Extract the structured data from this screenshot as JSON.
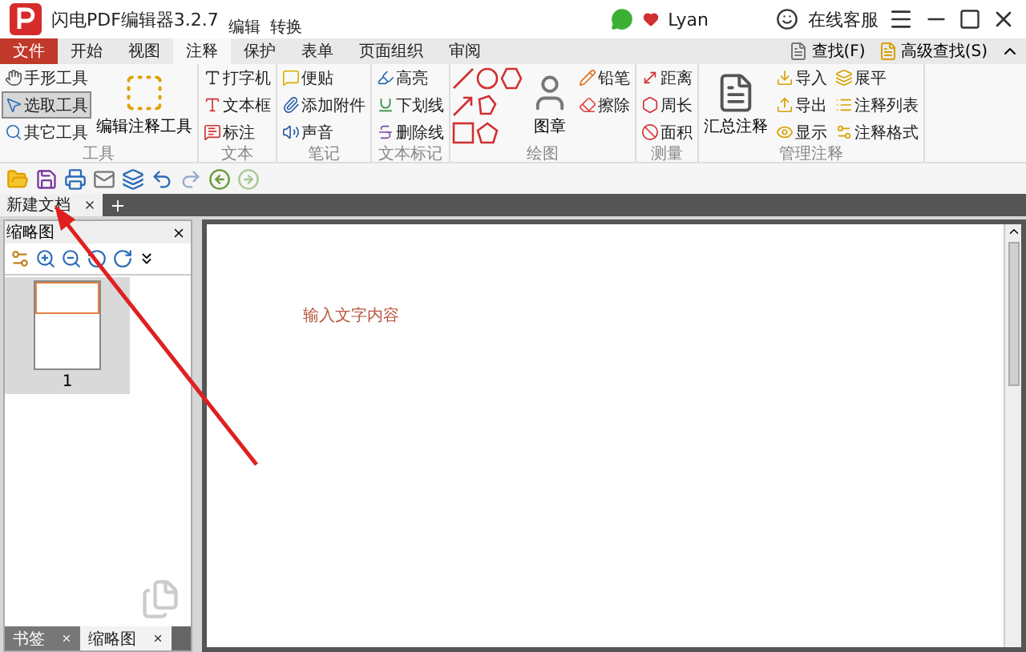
{
  "window": {
    "title": "闪电PDF编辑器3.2.7",
    "context_tabs": [
      "编辑",
      "转换"
    ],
    "user": "Lyan",
    "support": "在线客服"
  },
  "menu_tabs": [
    {
      "label": "文件",
      "kind": "file",
      "selected": false
    },
    {
      "label": "开始",
      "kind": "tab",
      "selected": false
    },
    {
      "label": "视图",
      "kind": "tab",
      "selected": false
    },
    {
      "label": "注释",
      "kind": "tab",
      "selected": true
    },
    {
      "label": "保护",
      "kind": "tab",
      "selected": false
    },
    {
      "label": "表单",
      "kind": "tab",
      "selected": false
    },
    {
      "label": "页面组织",
      "kind": "tab",
      "selected": false
    },
    {
      "label": "审阅",
      "kind": "tab",
      "selected": false
    }
  ],
  "search_buttons": [
    "查找(F)",
    "高级查找(S)"
  ],
  "ribbon_groups": [
    {
      "label": "工具",
      "columns": [
        {
          "kind": "stack",
          "items": [
            {
              "label": "手形工具",
              "selected": false
            },
            {
              "label": "选取工具",
              "selected": true
            },
            {
              "label": "其它工具",
              "selected": false
            }
          ]
        },
        {
          "kind": "large",
          "label": "编辑注释工具"
        }
      ]
    },
    {
      "label": "文本",
      "columns": [
        {
          "kind": "stack",
          "items": [
            {
              "label": "打字机"
            },
            {
              "label": "文本框"
            },
            {
              "label": "标注"
            }
          ]
        }
      ]
    },
    {
      "label": "笔记",
      "columns": [
        {
          "kind": "stack",
          "items": [
            {
              "label": "便贴"
            },
            {
              "label": "添加附件"
            },
            {
              "label": "声音"
            }
          ]
        }
      ]
    },
    {
      "label": "文本标记",
      "columns": [
        {
          "kind": "stack",
          "items": [
            {
              "label": "高亮"
            },
            {
              "label": "下划线"
            },
            {
              "label": "删除线"
            }
          ]
        }
      ]
    },
    {
      "label": "绘图",
      "columns": [
        {
          "kind": "shapes"
        },
        {
          "kind": "large",
          "label": "图章"
        },
        {
          "kind": "stack",
          "items": [
            {
              "label": "铅笔"
            },
            {
              "label": "擦除"
            }
          ]
        }
      ]
    },
    {
      "label": "测量",
      "columns": [
        {
          "kind": "stack",
          "items": [
            {
              "label": "距离"
            },
            {
              "label": "周长"
            },
            {
              "label": "面积"
            }
          ]
        }
      ]
    },
    {
      "label": "管理注释",
      "columns": [
        {
          "kind": "large",
          "label": "汇总注释"
        },
        {
          "kind": "stack",
          "items": [
            {
              "label": "导入"
            },
            {
              "label": "导出"
            },
            {
              "label": "显示"
            }
          ]
        },
        {
          "kind": "stack",
          "items": [
            {
              "label": "展平"
            },
            {
              "label": "注释列表"
            },
            {
              "label": "注释格式"
            }
          ]
        }
      ]
    }
  ],
  "document_tabs": [
    {
      "label": "新建文档",
      "selected": true
    }
  ],
  "thumbnail_panel": {
    "title": "缩略图",
    "pages": [
      {
        "label": "1",
        "selected": true
      }
    ]
  },
  "panel_tabs": [
    {
      "label": "书签",
      "selected": false
    },
    {
      "label": "缩略图",
      "selected": true
    }
  ],
  "page_text": "输入文字内容"
}
